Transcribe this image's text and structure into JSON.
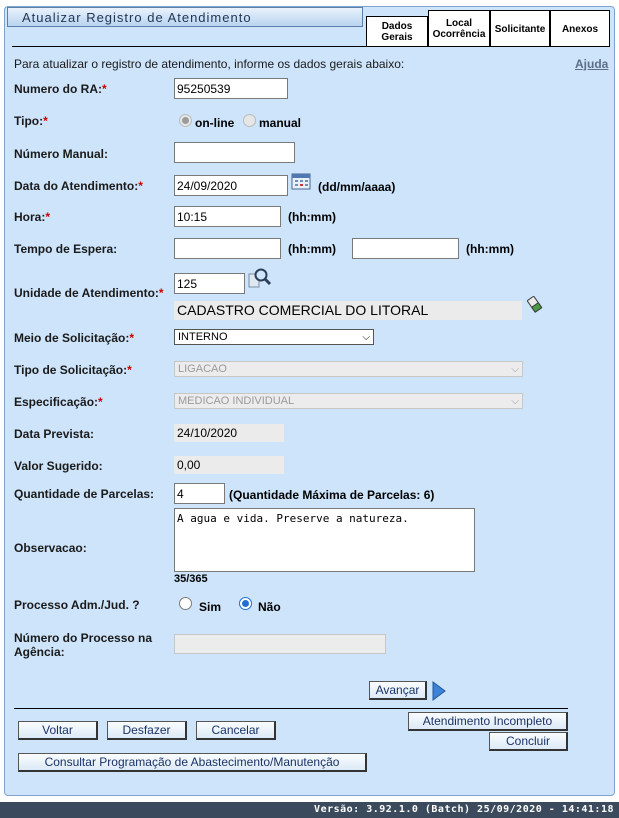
{
  "header": {
    "title": "Atualizar Registro de Atendimento",
    "intro": "Para atualizar o registro de atendimento, informe os dados gerais abaixo:",
    "help_link": "Ajuda"
  },
  "tabs": [
    {
      "label": "Dados\nGerais",
      "active": true
    },
    {
      "label": "Local\nOcorrência",
      "active": false
    },
    {
      "label": "Solicitante",
      "active": false
    },
    {
      "label": "Anexos",
      "active": false
    }
  ],
  "form": {
    "numero_ra": {
      "label": "Numero do RA:",
      "value": "95250539"
    },
    "tipo": {
      "label": "Tipo:",
      "options": [
        "on-line",
        "manual"
      ],
      "selected": "on-line"
    },
    "numero_manual": {
      "label": "Número Manual:",
      "value": ""
    },
    "data_atendimento": {
      "label": "Data do Atendimento:",
      "value": "24/09/2020",
      "format": "(dd/mm/aaaa)"
    },
    "hora": {
      "label": "Hora:",
      "value": "10:15",
      "format": "(hh:mm)"
    },
    "tempo_espera": {
      "label": "Tempo de Espera:",
      "start": "",
      "end": "",
      "format": "(hh:mm)"
    },
    "unidade": {
      "label": "Unidade de Atendimento:",
      "code": "125",
      "name": "CADASTRO COMERCIAL DO LITORAL"
    },
    "meio_solicitacao": {
      "label": "Meio de Solicitação:",
      "value": "INTERNO"
    },
    "tipo_solicitacao": {
      "label": "Tipo de Solicitação:",
      "value": "LIGACAO"
    },
    "especificacao": {
      "label": "Especificação:",
      "value": "MEDICAO INDIVIDUAL"
    },
    "data_prevista": {
      "label": "Data Prevista:",
      "value": "24/10/2020"
    },
    "valor_sugerido": {
      "label": "Valor Sugerido:",
      "value": "0,00"
    },
    "parcelas": {
      "label": "Quantidade de Parcelas:",
      "value": "4",
      "max_text": "(Quantidade Máxima de Parcelas: 6)"
    },
    "observacao": {
      "label": "Observacao:",
      "value": "A agua e vida. Preserve a natureza.",
      "counter": "35/365"
    },
    "processo": {
      "label": "Processo Adm./Jud. ?",
      "options": [
        "Sim",
        "Não"
      ],
      "selected": "Não"
    },
    "numero_processo": {
      "label": "Número do Processo na Agência:",
      "value": ""
    }
  },
  "buttons": {
    "avancar": "Avançar",
    "voltar": "Voltar",
    "desfazer": "Desfazer",
    "cancelar": "Cancelar",
    "atendimento_incompleto": "Atendimento Incompleto",
    "concluir": "Concluir",
    "consultar": "Consultar Programação de Abastecimento/Manutenção"
  },
  "footer": {
    "version": "Versão: 3.92.1.0 (Batch) 25/09/2020 - 14:41:18"
  },
  "colors": {
    "panel": "#cde4fb",
    "required": "#d00000",
    "footer_bg": "#3b4a5c"
  }
}
